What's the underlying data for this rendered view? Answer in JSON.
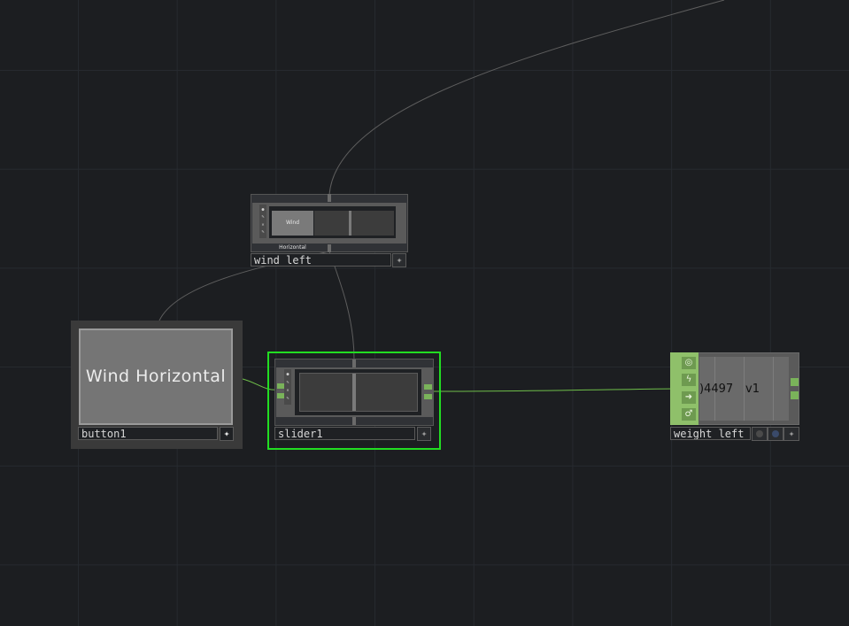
{
  "nodes": {
    "wind_left": {
      "name": "wind_left",
      "preview_label": "Wind Horizontal"
    },
    "button1": {
      "name": "button1",
      "button_label": "Wind Horizontal"
    },
    "slider1": {
      "name": "slider1"
    },
    "weight_left": {
      "name": "weight_left",
      "value_text": ")4497",
      "channel": "v1"
    }
  },
  "colors": {
    "background": "#1c1e21",
    "grid": "#262a2f",
    "selection": "#22dd22",
    "wire_green": "#6fbf4a",
    "wire_gray": "#6a6a6a",
    "chop_green": "#8fc06a"
  },
  "icons": {
    "flag": "star-four-point",
    "chop_viewer": "target",
    "chop_cook": "lightning",
    "chop_export": "arrow-right",
    "chop_bypass": "pin"
  }
}
